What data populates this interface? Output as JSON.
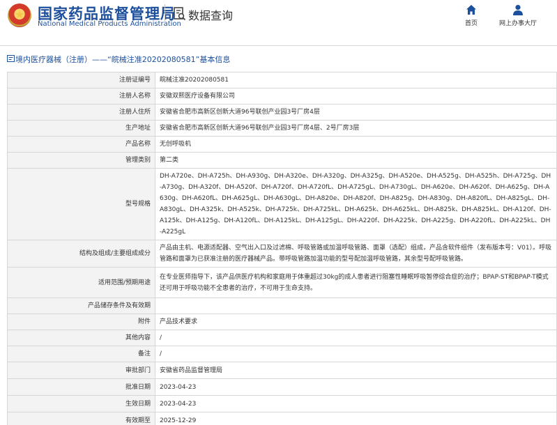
{
  "header": {
    "title_cn": "国家药品监督管理局",
    "title_en": "National Medical Products Administration",
    "section_title": "数据查询",
    "nav": [
      {
        "label": "首页",
        "icon": "home-icon"
      },
      {
        "label": "网上办事大厅",
        "icon": "user-icon"
      }
    ]
  },
  "breadcrumb": {
    "text": "境内医疗器械（注册）——“皖械注准20202080581”基本信息"
  },
  "colors": {
    "brand": "#1c4f9c",
    "label_bg": "#f3f3f3",
    "border": "#d6d6d6"
  },
  "record": [
    {
      "label": "注册证编号",
      "value": "皖械注准20202080581"
    },
    {
      "label": "注册人名称",
      "value": "安徽双熙医疗设备有限公司"
    },
    {
      "label": "注册人住所",
      "value": "安徽省合肥市高新区创新大道96号联创产业园3号厂房4层"
    },
    {
      "label": "生产地址",
      "value": "安徽省合肥市高新区创新大道96号联创产业园3号厂房4层、2号厂房3层"
    },
    {
      "label": "产品名称",
      "value": "无创呼吸机"
    },
    {
      "label": "管理类别",
      "value": "第二类"
    },
    {
      "label": "型号规格",
      "value": "DH-A720e、DH-A725h、DH-A930g、DH-A320e、DH-A320g、DH-A325g、DH-A520e、DH-A525g、DH-A525h、DH-A725g、DH-A730g、DH-A320f、DH-A520f、DH-A720f、DH-A720fL、DH-A725gL、DH-A730gL、DH-A620e、DH-A620f、DH-A625g、DH-A630g、DH-A620fL、DH-A625gL、DH-A630gL、DH-A820e、DH-A820f、DH-A825g、DH-A830g、DH-A820fL、DH-A825gL、DH-A830gL、DH-A325k、DH-A525k、DH-A725k、DH-A725kL、DH-A625k、DH-A625kL、DH-A825k、DH-A825kL、DH-A120f、DH-A125k、DH-A125g、DH-A120fL、DH-A125kL、DH-A125gL、DH-A220f、DH-A225k、DH-A225g、DH-A220fL、DH-A225kL、DH-A225gL"
    },
    {
      "label": "结构及组成/主要组成成分",
      "value": "产品由主机、电源适配器、空气出入口及过滤棉、呼吸管路或加温呼吸管路、面罩（选配）组成，产品含软件组件（发布版本号：V01）。呼吸管路和面罩为已获准注册的医疗器械产品。带呼吸管路加温功能的型号配加温呼吸管路，其余型号配呼吸管路。"
    },
    {
      "label": "适用范围/预期用途",
      "value": "在专业医师指导下，该产品供医疗机构和家庭用于体重超过30kg的成人患者进行阻塞性睡眠呼吸暂停综合症的治疗；BPAP-ST和BPAP-T模式还可用于呼吸功能不全患者的治疗，不可用于生命支持。"
    },
    {
      "label": "产品储存条件及有效期",
      "value": ""
    },
    {
      "label": "附件",
      "value": "产品技术要求"
    },
    {
      "label": "其他内容",
      "value": "/"
    },
    {
      "label": "备注",
      "value": "/"
    },
    {
      "label": "审批部门",
      "value": "安徽省药品监督管理局"
    },
    {
      "label": "批准日期",
      "value": "2023-04-23"
    },
    {
      "label": "生效日期",
      "value": "2023-04-23"
    },
    {
      "label": "有效期至",
      "value": "2025-12-29"
    }
  ]
}
